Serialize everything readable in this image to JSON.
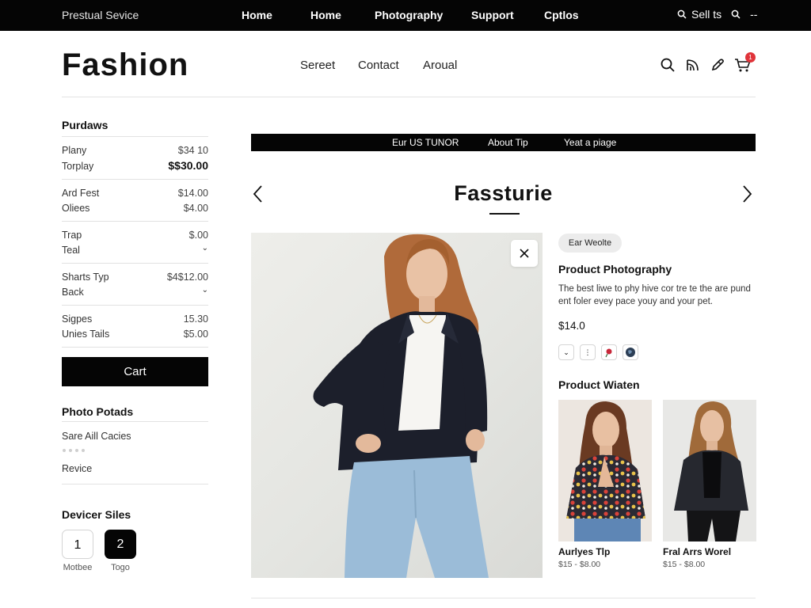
{
  "topbar": {
    "brand": "Prestual Sevice",
    "links": [
      "Home",
      "Home",
      "Photography",
      "Support",
      "Cptlos"
    ],
    "right_label": "Sell ts",
    "more_label": "--"
  },
  "header": {
    "logo": "Fashion",
    "nav": [
      "Sereet",
      "Contact",
      "Aroual"
    ],
    "cart_badge": "1",
    "icons": [
      "search-icon",
      "rss-icon",
      "edit-icon",
      "cart-icon"
    ]
  },
  "sidebar": {
    "purchases_title": "Purdaws",
    "rows": [
      {
        "label": "Plany",
        "value": "$34 10"
      },
      {
        "label": "Torplay",
        "value": "$$30.00"
      },
      {
        "label": "Ard Fest",
        "value": "$14.00"
      },
      {
        "label": "Oliees",
        "value": "$4.00"
      },
      {
        "label": "Trap",
        "value": "$.00"
      },
      {
        "label": "Teal",
        "value": ""
      },
      {
        "label": "Sharts Typ",
        "value": "$4$12.00"
      },
      {
        "label": "Back",
        "value": ""
      },
      {
        "label": "Sigpes",
        "value": "15.30"
      },
      {
        "label": "Unies Tails",
        "value": "$5.00"
      }
    ],
    "cart_button": "Cart",
    "photo_title": "Photo Potads",
    "photo_item1": "Sare Aill Cacies",
    "photo_item2": "Revice",
    "device_title": "Devicer Siles",
    "sizes": [
      {
        "value": "1",
        "caption": "Motbee"
      },
      {
        "value": "2",
        "caption": "Togo"
      }
    ]
  },
  "main": {
    "subnav": [
      "Eur US TUNOR",
      "About Tip",
      "Yeat a piage"
    ],
    "page_title": "Fassturie",
    "product": {
      "chip": "Ear Weolte",
      "title": "Product Photography",
      "description": "The best liwe to phy hive cor tre te the are pund ent foler evey pace youy and your pet.",
      "price": "$14.0",
      "swatches": [
        "chevron-icon",
        "grip-icon",
        "rose-icon",
        "globe-icon"
      ]
    },
    "related_title": "Product Wiaten",
    "related": [
      {
        "name": "Aurlyes Tlp",
        "price": "$15 - $8.00"
      },
      {
        "name": "Fral Arrs Worel",
        "price": "$15 - $8.00"
      }
    ]
  },
  "colors": {
    "bar": "#050505",
    "accent_badge": "#e0343a",
    "chip_bg": "#ececec"
  }
}
